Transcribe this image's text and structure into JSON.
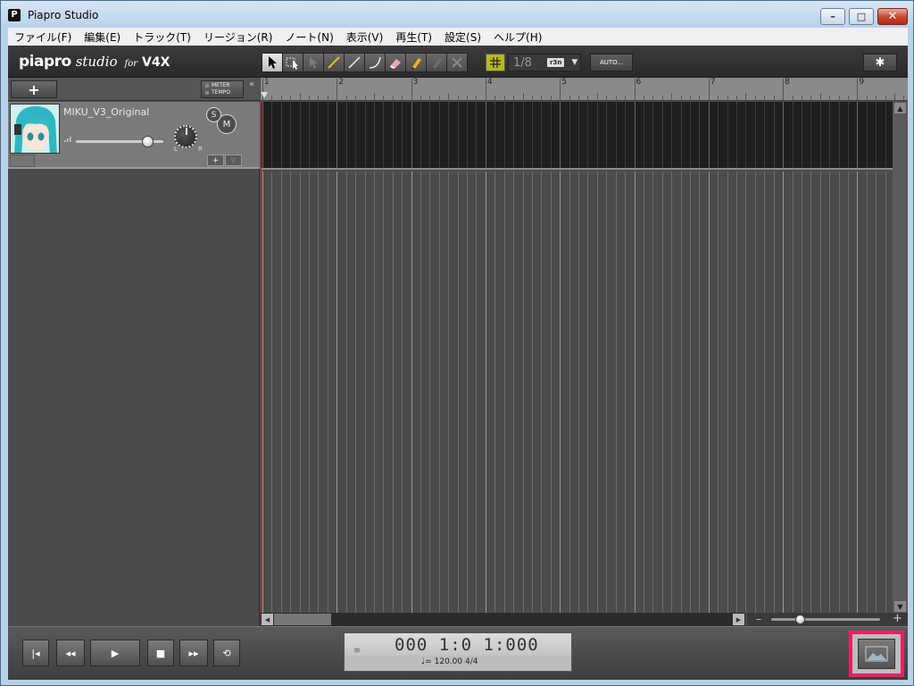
{
  "window": {
    "title": "Piapro Studio",
    "app_icon_letter": "P",
    "controls": {
      "minimize": "–",
      "maximize": "□",
      "close": "✕"
    }
  },
  "menu": [
    "ファイル(F)",
    "編集(E)",
    "トラック(T)",
    "リージョン(R)",
    "ノート(N)",
    "表示(V)",
    "再生(T)",
    "設定(S)",
    "ヘルプ(H)"
  ],
  "logo": {
    "part1": "piapro",
    "part2": "studio",
    "part3": "for",
    "part4": "V4X"
  },
  "toolbar": {
    "tools": [
      "arrow-select-icon",
      "range-select-icon",
      "grayed-arrow-icon",
      "pencil-line-icon",
      "straight-line-icon",
      "curve-line-icon",
      "eraser-icon",
      "pen-icon",
      "disabled-pen-icon",
      "cross-icon"
    ],
    "quantize_value": "1/8",
    "triplet_label": "r3n",
    "auto_label": "AUTO...",
    "accent": "#b8b820"
  },
  "track_panel": {
    "add_label": "+",
    "meter_label": "METER",
    "tempo_label": "TEMPO",
    "collapse": "«"
  },
  "track": {
    "name": "MIKU_V3_Original",
    "solo": "S",
    "mute": "M",
    "pan_l": "L",
    "pan_r": "R",
    "add": "+",
    "fold": "▽",
    "volume_level": 0.82
  },
  "ruler": {
    "bars": [
      "1",
      "2",
      "3",
      "4",
      "5",
      "6",
      "7",
      "8",
      "9"
    ]
  },
  "transport": {
    "counter_time": "000 1:0 1:000",
    "tempo_sig": "♩= 120.00  4/4",
    "buttons": {
      "to_start": "|◂",
      "rewind": "◂◂",
      "play": "▶",
      "stop": "■",
      "fast_forward": "▸▸",
      "loop": "⟲"
    }
  },
  "zoom": {
    "minus": "–",
    "plus": "+",
    "level": 0.05
  },
  "colors": {
    "playhead": "#c0302a",
    "highlight": "#ec1e63"
  }
}
